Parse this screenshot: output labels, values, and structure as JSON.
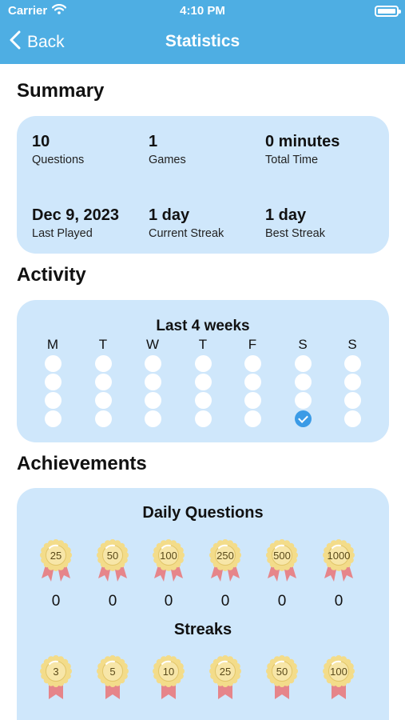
{
  "status": {
    "carrier": "Carrier",
    "time": "4:10 PM"
  },
  "nav": {
    "back": "Back",
    "title": "Statistics"
  },
  "summary": {
    "title": "Summary",
    "stats": [
      {
        "value": "10",
        "label": "Questions"
      },
      {
        "value": "1",
        "label": "Games"
      },
      {
        "value": "0 minutes",
        "label": "Total Time"
      },
      {
        "value": "Dec 9, 2023",
        "label": "Last Played"
      },
      {
        "value": "1 day",
        "label": "Current Streak"
      },
      {
        "value": "1 day",
        "label": "Best Streak"
      }
    ]
  },
  "activity": {
    "title": "Activity",
    "subtitle": "Last 4 weeks",
    "days": [
      "M",
      "T",
      "W",
      "T",
      "F",
      "S",
      "S"
    ],
    "weeks": [
      [
        false,
        false,
        false,
        false,
        false,
        false,
        false
      ],
      [
        false,
        false,
        false,
        false,
        false,
        false,
        false
      ],
      [
        false,
        false,
        false,
        false,
        false,
        false,
        false
      ],
      [
        false,
        false,
        false,
        false,
        false,
        true,
        false
      ]
    ]
  },
  "achievements": {
    "title": "Achievements",
    "daily": {
      "title": "Daily Questions",
      "medals": [
        "25",
        "50",
        "100",
        "250",
        "500",
        "1000"
      ],
      "counts": [
        "0",
        "0",
        "0",
        "0",
        "0",
        "0"
      ]
    },
    "streaks": {
      "title": "Streaks",
      "medals": [
        "3",
        "5",
        "10",
        "25",
        "50",
        "100"
      ]
    }
  },
  "colors": {
    "header": "#4eaee3",
    "card": "#cfe7fb",
    "check": "#3b9be6",
    "medal_gold": "#f3dc8a",
    "ribbon": "#e6858a"
  }
}
